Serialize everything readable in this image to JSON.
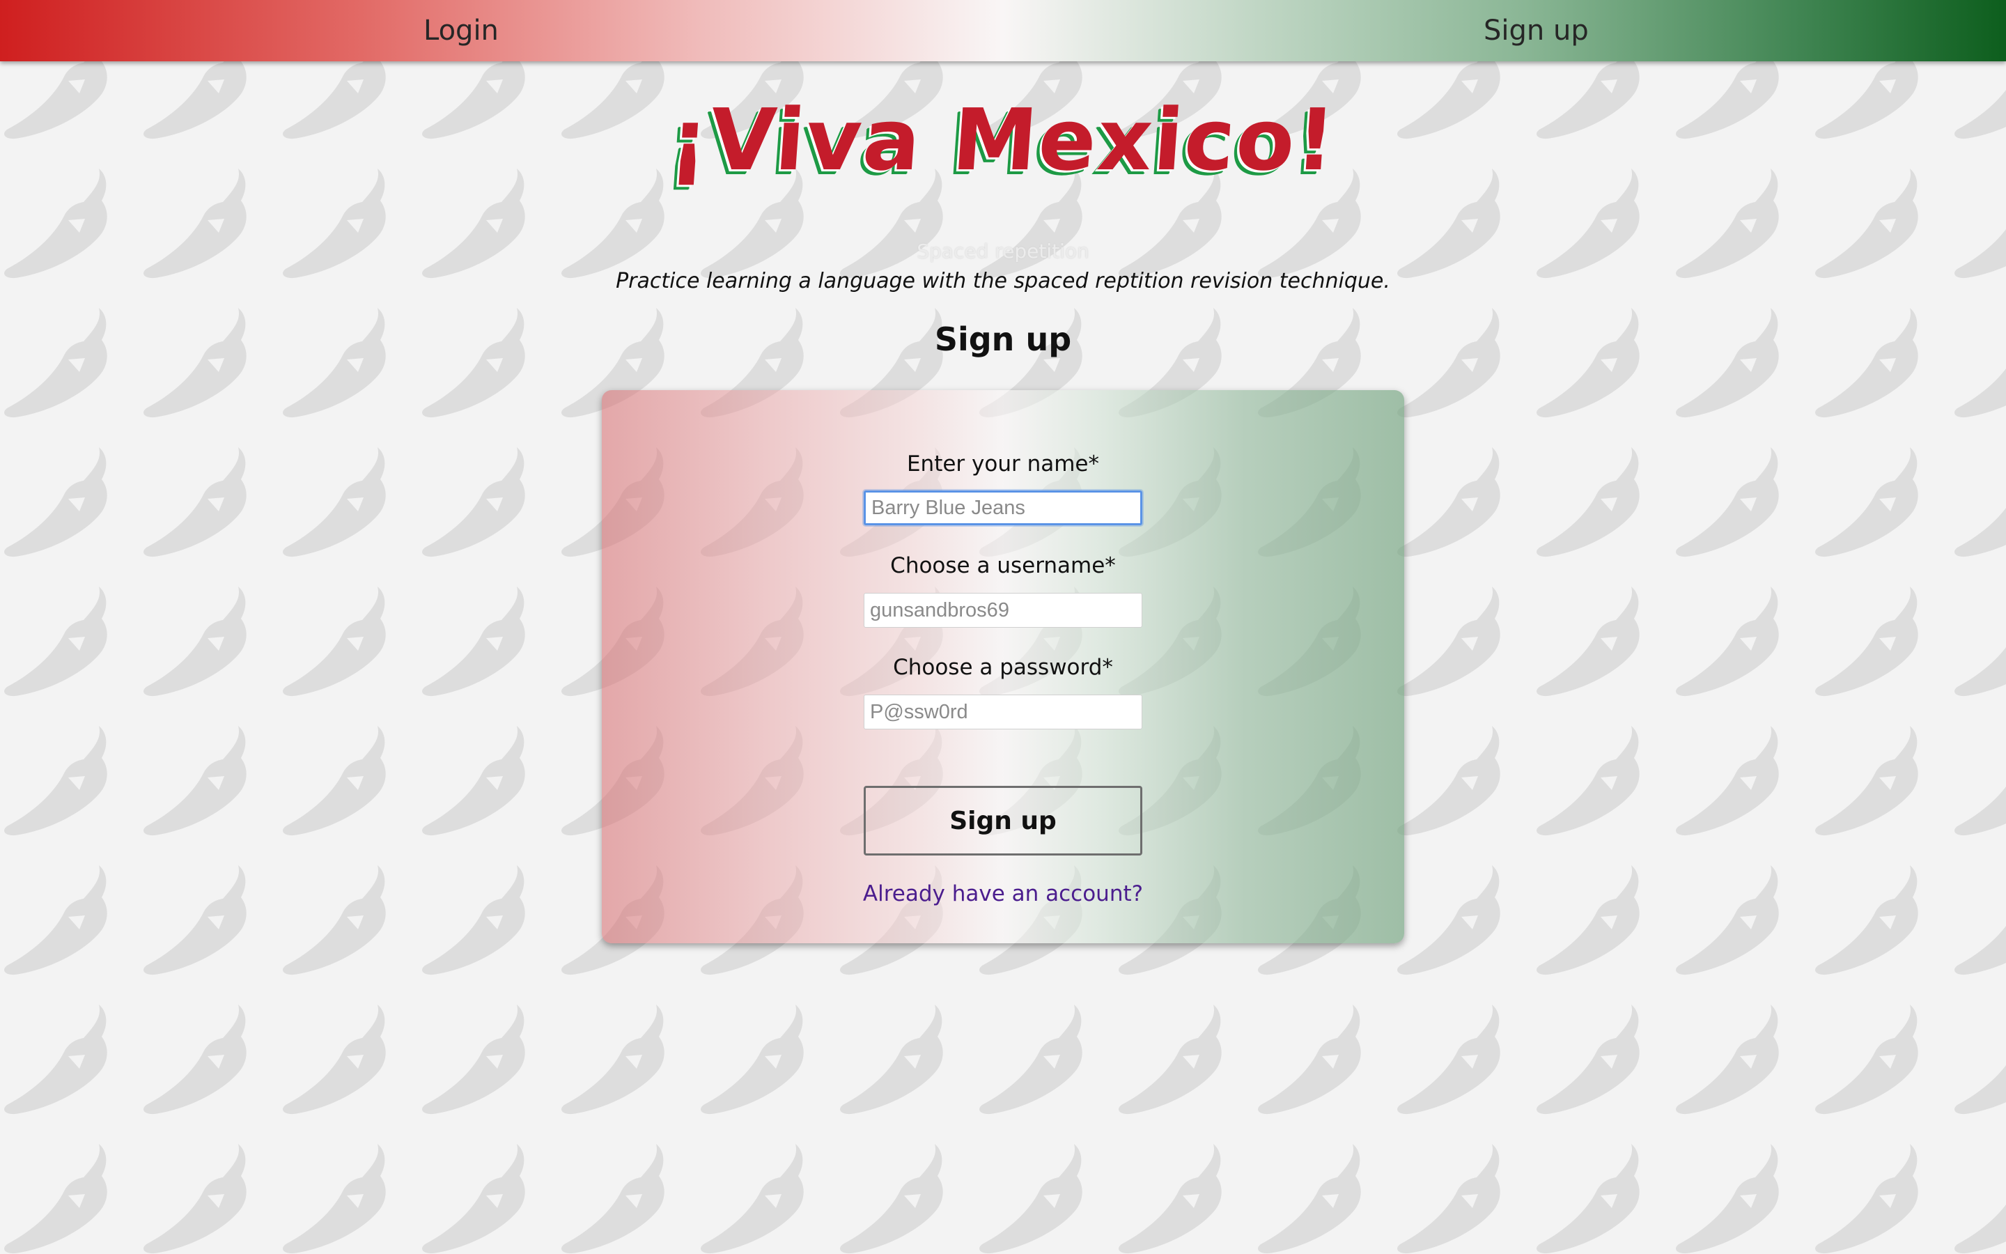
{
  "nav": {
    "login_label": "Login",
    "signup_label": "Sign up"
  },
  "header": {
    "logo_text": "¡Viva Mexico!",
    "subtitle": "Spaced repetition",
    "tagline": "Practice learning a language with the spaced reptition revision technique."
  },
  "page": {
    "heading": "Sign up"
  },
  "form": {
    "name_label": "Enter your name*",
    "name_placeholder": "Barry Blue Jeans",
    "username_label": "Choose a username*",
    "username_placeholder": "gunsandbros69",
    "password_label": "Choose a password*",
    "password_placeholder": "P@ssw0rd",
    "submit_label": "Sign up",
    "login_link": "Already have an account?"
  },
  "icons": {
    "background_pattern": "chili-pepper-icon"
  },
  "colors": {
    "flag_red": "#cf1f1f",
    "flag_white": "#f9f6f6",
    "flag_green": "#0d5e1d",
    "logo_red": "#c41c2b",
    "logo_green_outline": "#1d9a45",
    "link_purple": "#4b1d8e",
    "focus_blue": "#5a93e6"
  }
}
